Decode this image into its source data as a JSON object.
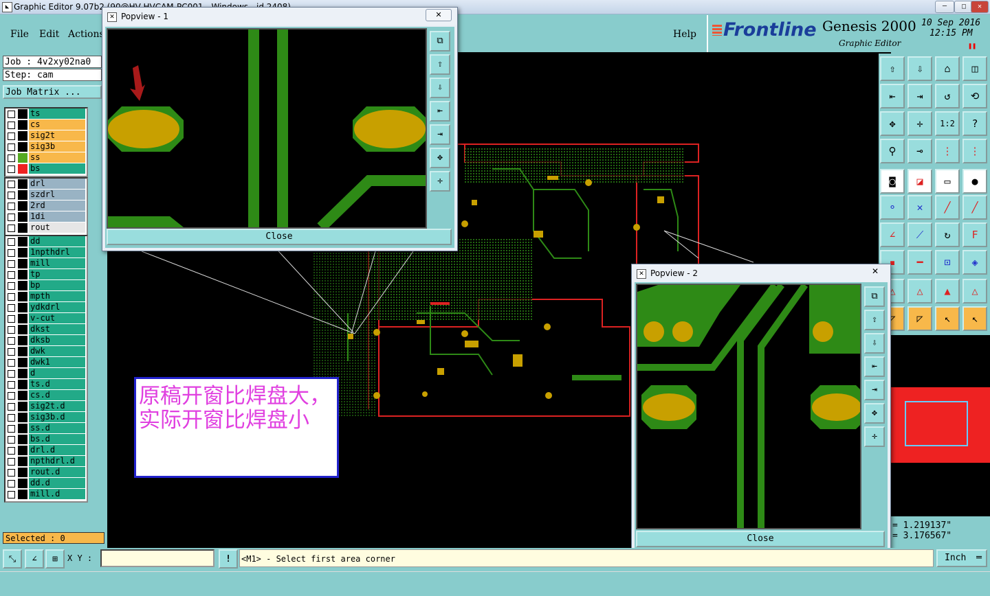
{
  "window": {
    "title": "Graphic Editor 9.07b2 (90@HV-HVCAM-PC001 - Windows - id 2408)",
    "min": "─",
    "max": "□",
    "close": "✕"
  },
  "menu": {
    "file": "File",
    "edit": "Edit",
    "actions": "Actions",
    "help": "Help"
  },
  "brand": {
    "logo": "Frontline",
    "product": "Genesis 2000",
    "subtitle": "Graphic Editor",
    "date": "10  Sep 2016",
    "time": "12:15  PM"
  },
  "job": {
    "job_line": "Job : 4v2xy02na0",
    "step_line": "Step: cam",
    "matrix_button": "Job Matrix ..."
  },
  "layers_group1": [
    {
      "name": "ts",
      "color": "#22aa88",
      "swatch": "#000000"
    },
    {
      "name": "cs",
      "color": "#f8b84a",
      "swatch": "#000000"
    },
    {
      "name": "sig2t",
      "color": "#f8b84a",
      "swatch": "#000000"
    },
    {
      "name": "sig3b",
      "color": "#f8b84a",
      "swatch": "#000000"
    },
    {
      "name": "ss",
      "color": "#f8b84a",
      "swatch": "#55aa22"
    },
    {
      "name": "bs",
      "color": "#22aa88",
      "swatch": "#ee2222"
    }
  ],
  "layers_group2": [
    {
      "name": "drl",
      "color": "#99b3c4"
    },
    {
      "name": "szdrl",
      "color": "#99b3c4"
    },
    {
      "name": "2rd",
      "color": "#99b3c4"
    },
    {
      "name": "1di",
      "color": "#99b3c4"
    },
    {
      "name": "rout",
      "color": "#e6e6e6"
    }
  ],
  "layers_group3": [
    "dd",
    "1npthdrl",
    "mill",
    "tp",
    "bp",
    "mpth",
    "ydkdrl",
    "v-cut",
    "dkst",
    "dksb",
    "dwk",
    "dwk1",
    "d",
    "ts.d",
    "cs.d",
    "sig2t.d",
    "sig3b.d",
    "ss.d",
    "bs.d",
    "drl.d",
    "npthdrl.d",
    "rout.d",
    "dd.d",
    "mill.d"
  ],
  "selected": "Selected : 0",
  "popview1": {
    "title": "Popview - 1",
    "close": "Close"
  },
  "popview2": {
    "title": "Popview - 2",
    "close": "Close"
  },
  "annotation": {
    "text": "原稿开窗比焊盘大，实际开窗比焊盘小"
  },
  "coords": {
    "x": "= 1.219137\"",
    "y": "= 3.176567\""
  },
  "bottom": {
    "xy_label": "X Y :",
    "xy_value": "",
    "message": "<M1> - Select first area corner",
    "units": "Inch"
  },
  "colors": {
    "board_green": "#2e8a16",
    "pad_yellow": "#c8a000",
    "background": "#88cccc",
    "red_layer": "#ee2222"
  }
}
